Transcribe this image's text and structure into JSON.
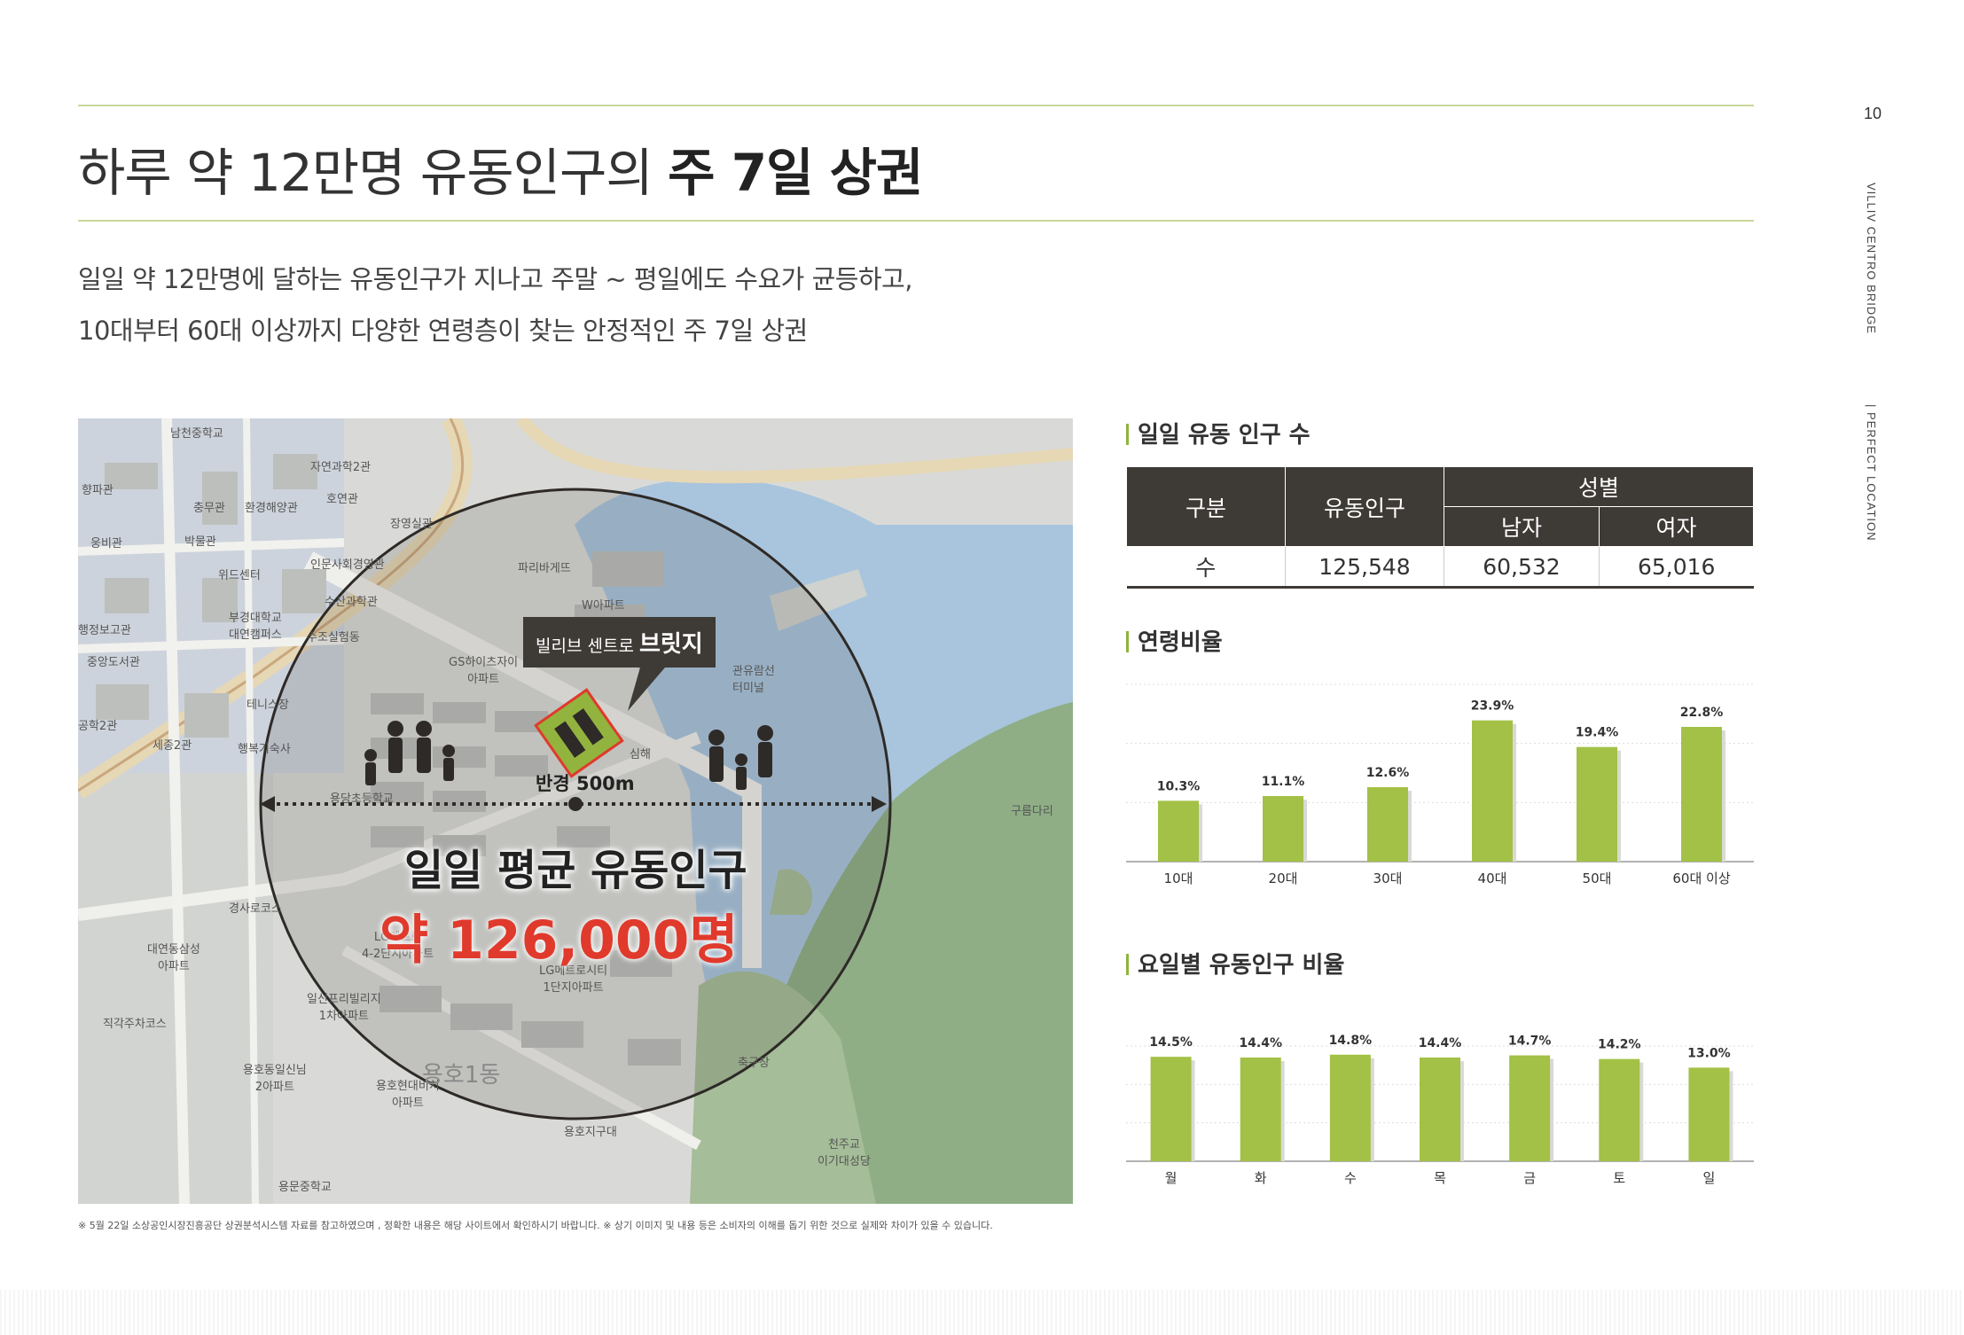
{
  "page": {
    "number": "10",
    "side_brand": "VILLIV CENTRO BRIDGE",
    "side_section": "| PERFECT LOCATION"
  },
  "header": {
    "title_light": "하루 약 12만명 유동인구의",
    "title_bold": "주 7일 상권",
    "subtitle_line1": "일일 약 12만명에 달하는 유동인구가 지나고 주말 ~ 평일에도 수요가 균등하고,",
    "subtitle_line2": "10대부터 60대 이상까지 다양한 연령층이 찾는 안정적인 주 7일 상권"
  },
  "map": {
    "badge_prefix": "빌리브 센트로",
    "badge_name": "브릿지",
    "radius_label": "반경 500m",
    "headline": "일일 평균 유동인구",
    "headline_value": "약 126,000명",
    "labels": {
      "l1": "남천중학교",
      "l2": "향파관",
      "l3": "자연과학2관",
      "l4": "충무관",
      "l5": "환경해양관",
      "l6": "호연관",
      "l7": "웅비관",
      "l8": "박물관",
      "l9": "장영실관",
      "l10": "인문사회경영관",
      "l11": "위드센터",
      "l12": "수산과학관",
      "l13": "부경대학교\n대연캠퍼스",
      "l14": "행정보고관",
      "l15": "중앙도서관",
      "l16": "수조실험동",
      "l17": "파리바게뜨",
      "l18": "W아파트",
      "l19": "GS하이츠자이\n아파트",
      "l20": "관유람선\n터미널",
      "l21": "테니스장",
      "l22": "공학2관",
      "l23": "세종2관",
      "l24": "행복기숙사",
      "l25": "구름다리",
      "l26": "경사로코스",
      "l27": "대연동삼성\n아파트",
      "l28": "직각주차코스",
      "l29": "LG메트로시티\n1단지아파트",
      "l30": "일신프리빌리지\n1차아파트",
      "l31": "용호동일신님\n2아파트",
      "l32": "용호현대비치\n아파트",
      "l33": "축구장",
      "l34": "용호지구대",
      "l35": "천주교\n이기대성당",
      "l36": "용문중학교",
      "l37": "용호1동",
      "l38": "심해",
      "l39": "용당초등학교",
      "l40": "LG메트로\n4-2단지아파트"
    }
  },
  "footnote": "※ 5월 22일 소상공인시장진흥공단 상권분석시스템 자료를 참고하였으며 , 정확한 내용은 해당 사이트에서 확인하시기 바랍니다. ※ 상기 이미지 및 내용 등은 소비자의 이해를 돕기 위한 것으로 실제와 차이가 있을  수 있습니다.",
  "daily_table": {
    "title": "일일 유동 인구 수",
    "headers": {
      "category": "구분",
      "population": "유동인구",
      "gender": "성별",
      "male": "남자",
      "female": "여자"
    },
    "row": {
      "category": "수",
      "population": "125,548",
      "male": "60,532",
      "female": "65,016"
    }
  },
  "chart_data": [
    {
      "type": "bar",
      "title": "연령비율",
      "categories": [
        "10대",
        "20대",
        "30대",
        "40대",
        "50대",
        "60대 이상"
      ],
      "values": [
        10.3,
        11.1,
        12.6,
        23.9,
        19.4,
        22.8
      ],
      "value_labels": [
        "10.3%",
        "11.1%",
        "12.6%",
        "23.9%",
        "19.4%",
        "22.8%"
      ],
      "ylim": [
        0,
        30
      ],
      "grid": true,
      "color": "#a3c146"
    },
    {
      "type": "bar",
      "title": "요일별 유동인구 비율",
      "categories": [
        "월",
        "화",
        "수",
        "목",
        "금",
        "토",
        "일"
      ],
      "values": [
        14.5,
        14.4,
        14.8,
        14.4,
        14.7,
        14.2,
        13.0
      ],
      "value_labels": [
        "14.5%",
        "14.4%",
        "14.8%",
        "14.4%",
        "14.7%",
        "14.2%",
        "13.0%"
      ],
      "ylim": [
        0,
        16
      ],
      "grid": true,
      "color": "#a3c146"
    }
  ]
}
